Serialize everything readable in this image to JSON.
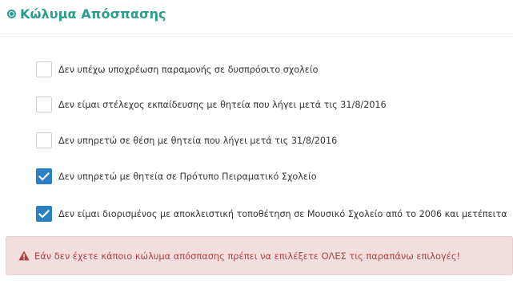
{
  "section": {
    "title": "Κώλυμα Απόσπασης"
  },
  "options": [
    {
      "label": "Δεν υπέχω υποχρέωση παραμονής σε δυσπρόσιτο σχολείο",
      "checked": false
    },
    {
      "label": "Δεν είμαι στέλεχος εκπαίδευσης με θητεία που λήγει μετά τις 31/8/2016",
      "checked": false
    },
    {
      "label": "Δεν υπηρετώ σε θέση με θητεία που λήγει μετά τις 31/8/2016",
      "checked": false
    },
    {
      "label": "Δεν υπηρετώ με θητεία σε Πρότυπο Πειραματικό Σχολείο",
      "checked": true
    },
    {
      "label": "Δεν είμαι διορισμένος με αποκλειστική τοποθέτηση σε Μουσικό Σχολείο από το 2006 και μετέπειτα",
      "checked": true
    }
  ],
  "alert": {
    "text": "Εάν δεν έχετε κάποιο κώλυμα απόσπασης πρέπει να επιλέξετε ΟΛΕΣ τις παραπάνω επιλογές!",
    "icon": "warning-icon"
  },
  "colors": {
    "accent": "#2a9d8f",
    "checkbox_checked": "#2b7fc4",
    "alert_bg": "#f2dede",
    "alert_text": "#a94442"
  }
}
